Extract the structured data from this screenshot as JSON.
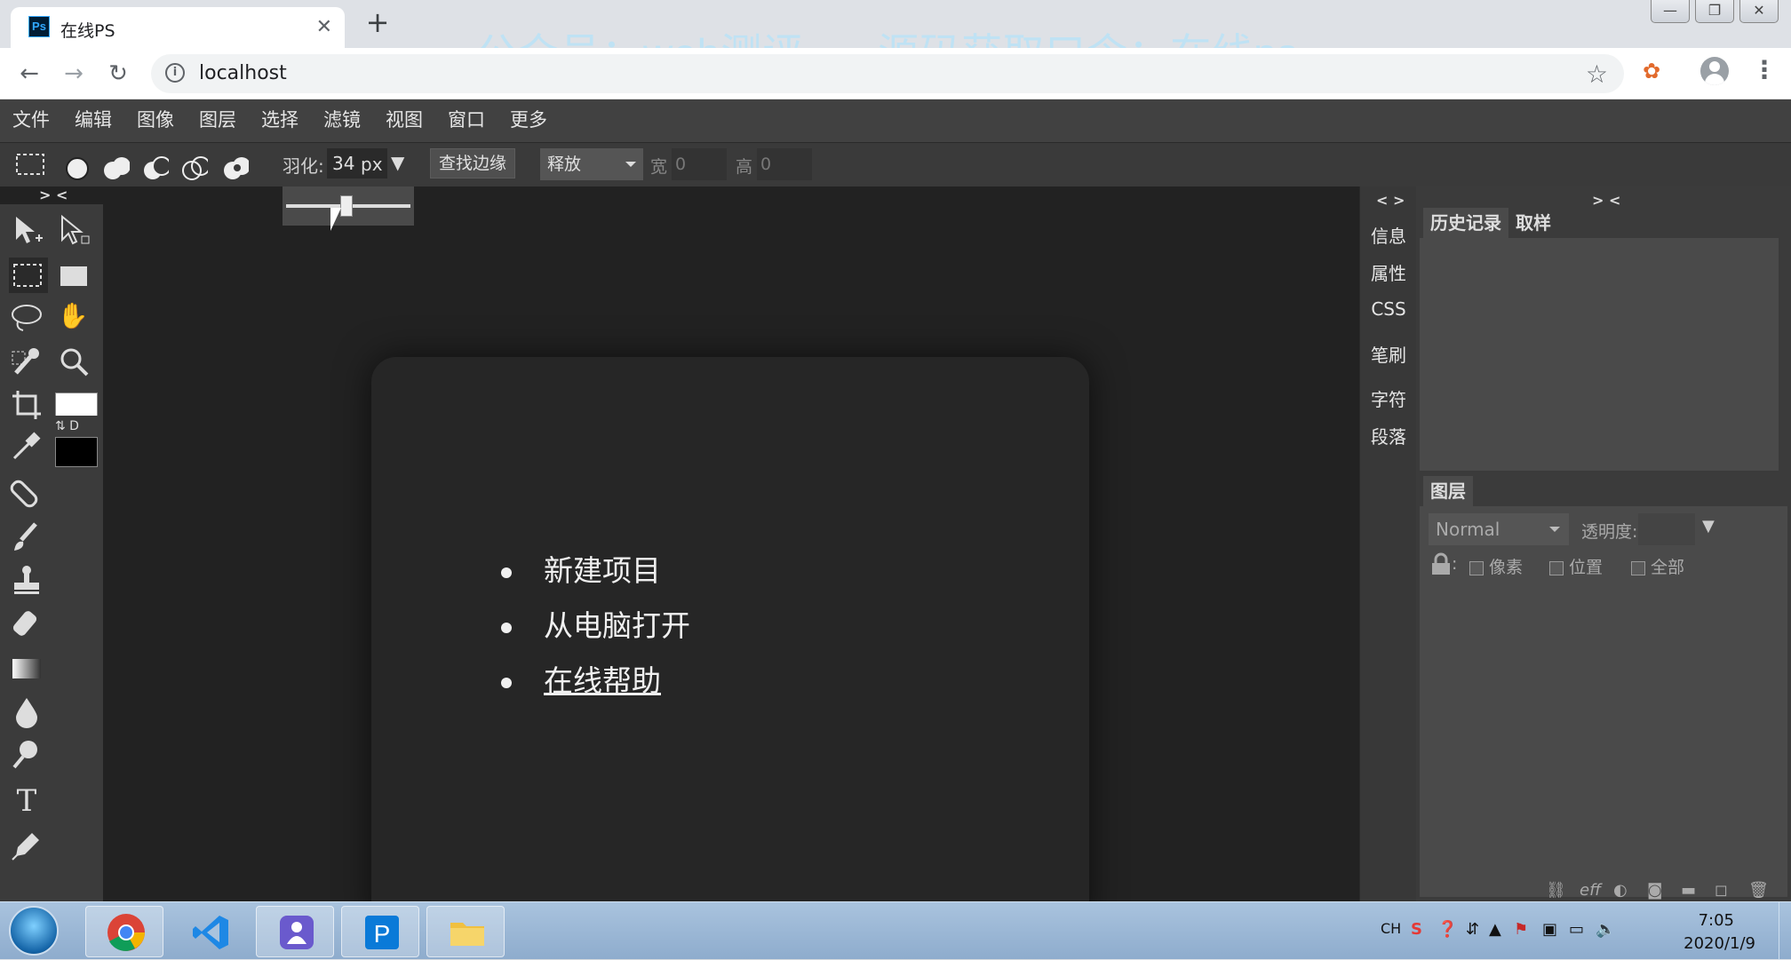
{
  "browser": {
    "tab_title": "在线PS",
    "tab_favicon": "Ps",
    "tab_close": "✕",
    "new_tab": "+",
    "url": "localhost",
    "window_buttons": [
      "—",
      "❐",
      "✕"
    ],
    "watermark": "公众号：web测评      源码获取口令：在线ps"
  },
  "menubar": [
    "文件",
    "编辑",
    "图像",
    "图层",
    "选择",
    "滤镜",
    "视图",
    "窗口",
    "更多"
  ],
  "options": {
    "feather_label": "羽化:",
    "feather_value": "34",
    "feather_unit": "px",
    "feather_slider_fraction": 0.34,
    "find_edge": "查找边缘",
    "release": "释放",
    "width_label": "宽",
    "width_value": "0",
    "height_label": "高",
    "height_value": "0"
  },
  "tools": {
    "collapse": "> <",
    "swatch_labels": "⇅ D"
  },
  "start_menu": {
    "items": [
      "新建项目",
      "从电脑打开",
      "在线帮助"
    ]
  },
  "side_tabs": {
    "toggle": "< >",
    "items": [
      "信息",
      "属性",
      "CSS",
      "笔刷",
      "字符",
      "段落"
    ]
  },
  "panels": {
    "toggle": "> <",
    "history_tabs": [
      "历史记录",
      "取样"
    ],
    "layers_tab": "图层",
    "blend_mode": "Normal",
    "opacity_label": "透明度:",
    "lock_suffix": ":",
    "lock_options": [
      "像素",
      "位置",
      "全部"
    ],
    "footer_eff": "eff"
  },
  "taskbar": {
    "lang": "CH",
    "time": "7:05",
    "date": "2020/1/9"
  },
  "colors": {
    "app_bg": "#222222",
    "menubar": "#414141",
    "panel": "#3b3b3b",
    "taskbar": "#9db8d6"
  }
}
